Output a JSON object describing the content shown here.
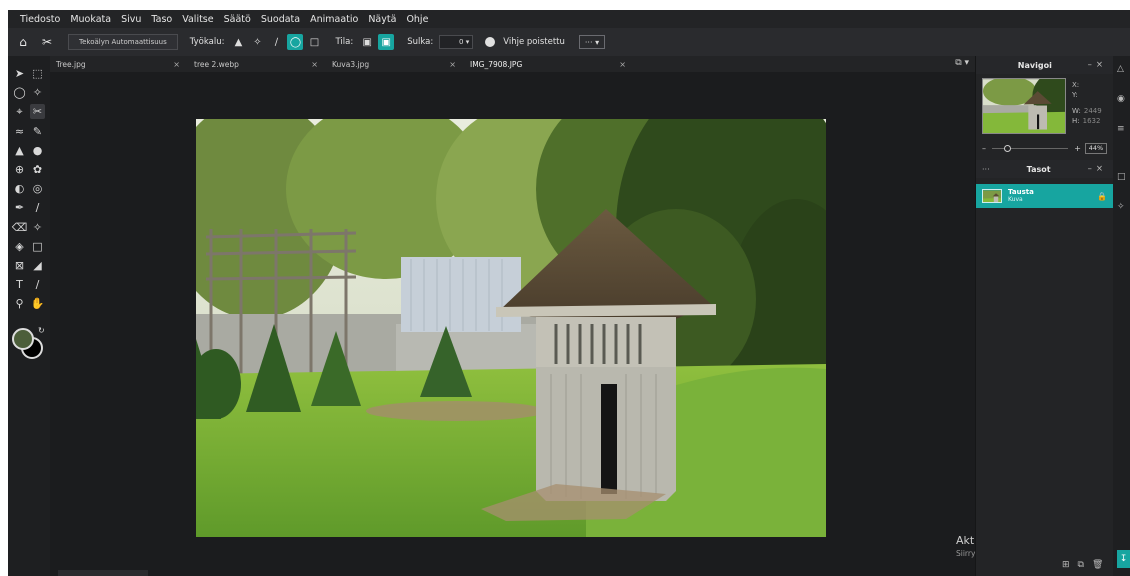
{
  "menu": [
    "Tiedosto",
    "Muokata",
    "Sivu",
    "Taso",
    "Valitse",
    "Säätö",
    "Suodata",
    "Animaatio",
    "Näytä",
    "Ohje"
  ],
  "options": {
    "auto_select_label": "Tekoälyn Automaattisuus",
    "tool_label": "Työkalu:",
    "mode_label": "Tila:",
    "feather_label": "Sulka:",
    "feather_value": "0",
    "hint_label": "Vihje poistettu",
    "more_label": "···"
  },
  "tabs": [
    {
      "name": "Tree.jpg",
      "close": "×"
    },
    {
      "name": "tree 2.webp",
      "close": "×"
    },
    {
      "name": "Kuva3.jpg",
      "close": "×"
    },
    {
      "name": "IMG_7908.JPG",
      "close": "×"
    }
  ],
  "navigator": {
    "title": "Navigoi",
    "x_label": "X:",
    "y_label": "Y:",
    "w_label": "W:",
    "w_value": "2449",
    "h_label": "H:",
    "h_value": "1632",
    "zoom": "44%"
  },
  "layers": {
    "title": "Tasot",
    "menu_dots": "···",
    "items": [
      {
        "name": "Tausta",
        "sub": "Kuva"
      }
    ]
  },
  "windows_notice": {
    "line1": "Aktivoi Windows",
    "line2": "Siirry asetuksiin ja aktivoi Windows."
  },
  "colors": {
    "accent": "#17a5a0",
    "foreground": "#4c5e3a",
    "background": "#000000"
  }
}
